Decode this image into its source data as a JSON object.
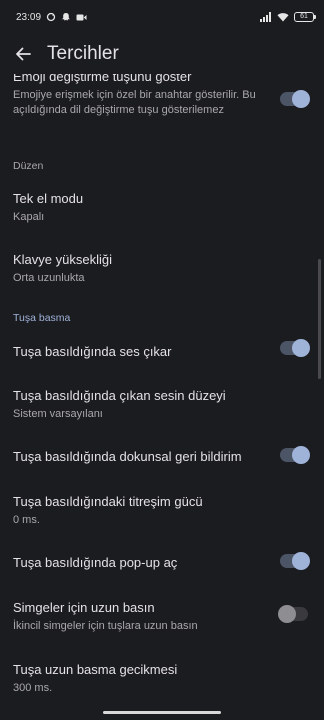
{
  "status_bar": {
    "time": "23:09",
    "left_icons": [
      "sync-icon",
      "ghost-notification-icon",
      "video-camera-icon"
    ],
    "right_icons": [
      "signal-icon",
      "wifi-icon"
    ],
    "battery": "61"
  },
  "app_bar": {
    "title": "Tercihler",
    "back_icon": "arrow-back-icon"
  },
  "top_item": {
    "title": "Emoji değiştirme tuşunu göster",
    "summary": "Emojiye erişmek için özel bir anahtar gösterilir. Bu açıldığında dil değiştirme tuşu gösterilemez",
    "toggle": true
  },
  "sections": {
    "layout": "Düzen",
    "keypress": "Tuşa basma"
  },
  "layout_items": [
    {
      "title": "Tek el modu",
      "summary": "Kapalı"
    },
    {
      "title": "Klavye yüksekliği",
      "summary": "Orta uzunlukta"
    }
  ],
  "keypress_items": [
    {
      "title": "Tuşa basıldığında ses çıkar",
      "toggle": true
    },
    {
      "title": "Tuşa basıldığında çıkan sesin düzeyi",
      "summary": "Sistem varsayılanı"
    },
    {
      "title": "Tuşa basıldığında dokunsal geri bildirim",
      "toggle": true
    },
    {
      "title": "Tuşa basıldığındaki titreşim gücü",
      "summary": "0 ms."
    },
    {
      "title": "Tuşa basıldığında pop-up aç",
      "toggle": true
    },
    {
      "title": "Simgeler için uzun basın",
      "summary": "İkincil simgeler için tuşlara uzun basın",
      "toggle": false
    },
    {
      "title": "Tuşa uzun basma gecikmesi",
      "summary": "300 ms."
    }
  ],
  "colors": {
    "background": "#1b1c20",
    "accent": "#9fb2d8",
    "text_primary": "#e4e2e6",
    "text_secondary": "#a9a8ad"
  }
}
